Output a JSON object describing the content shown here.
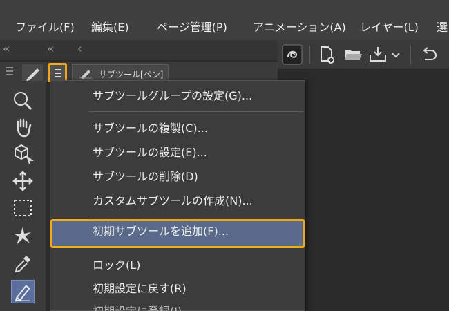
{
  "menubar": {
    "items": [
      "ファイル(F)",
      "編集(E)",
      "ページ管理(P)",
      "アニメーション(A)",
      "レイヤー(L)",
      "選"
    ]
  },
  "palette": {
    "subtool_tab_label": "サブツール[ペン]"
  },
  "context_menu": {
    "items": [
      "サブツールグループの設定(G)...",
      "サブツールの複製(C)...",
      "サブツールの設定(E)...",
      "サブツールの削除(D)",
      "カスタムサブツールの作成(N)...",
      "初期サブツールを追加(F)...",
      "ロック(L)",
      "初期設定に戻す(R)",
      "初期設定に登録(I)"
    ],
    "highlighted_item": "初期サブツールを追加(F)..."
  },
  "colors": {
    "highlight_border": "#f2a81d",
    "highlight_fill": "#5a6a8a",
    "active_tool": "#5a6f9e"
  },
  "icons": {
    "strip": [
      "double-chevron-left-icon",
      "double-chevron-left-icon",
      "chevron-left-icon"
    ],
    "command_bar": [
      "clip-logo-icon",
      "new-file-icon",
      "open-folder-icon",
      "save-icon",
      "dropdown-chevron-icon",
      "undo-icon"
    ],
    "tools": [
      "zoom-icon",
      "hand-icon",
      "object-icon",
      "move-icon",
      "selection-icon",
      "auto-select-icon",
      "eyedropper-icon",
      "pen-icon"
    ]
  }
}
